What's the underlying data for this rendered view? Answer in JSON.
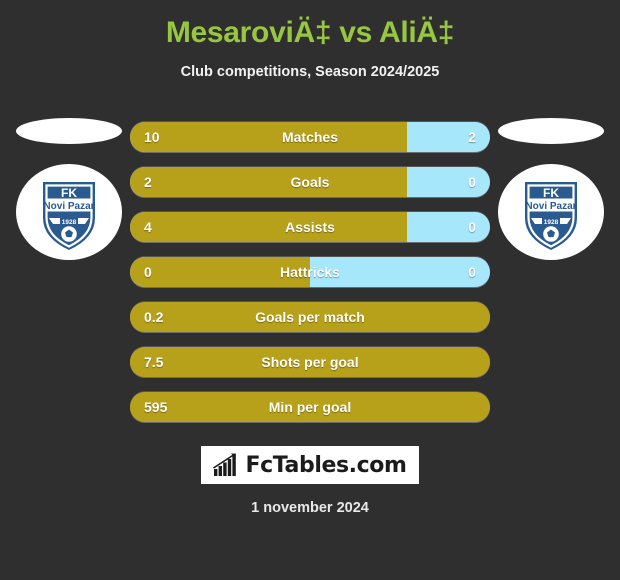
{
  "header": {
    "title": "MesaroviÄ‡ vs AliÄ‡",
    "subtitle": "Club competitions, Season 2024/2025"
  },
  "colors": {
    "background": "#302f2f",
    "title_green": "#97c63f",
    "home_gold": "#b8a11a",
    "away_blue": "#a6e7fb",
    "badge_white": "#ffffff",
    "crest_blue": "#2a5b90"
  },
  "badges": {
    "home": {
      "club_name": "FK Novi Pazar",
      "crest_line1": "FK",
      "crest_line2": "Novi Pazar",
      "crest_year": "1928",
      "icon": "club-crest-icon"
    },
    "away": {
      "club_name": "FK Novi Pazar",
      "crest_line1": "FK",
      "crest_line2": "Novi Pazar",
      "crest_year": "1928",
      "icon": "club-crest-icon"
    }
  },
  "chart_data": {
    "type": "bar",
    "title": "MesaroviÄ‡ vs AliÄ‡",
    "subtitle": "Club competitions, Season 2024/2025",
    "orientation": "horizontal-split",
    "categories": [
      "Matches",
      "Goals",
      "Assists",
      "Hattricks",
      "Goals per match",
      "Shots per goal",
      "Min per goal"
    ],
    "series": [
      {
        "name": "MesaroviÄ‡",
        "values": [
          "10",
          "2",
          "4",
          "0",
          "0.2",
          "7.5",
          "595"
        ]
      },
      {
        "name": "AliÄ‡",
        "values": [
          "2",
          "0",
          "0",
          "0",
          "",
          "",
          ""
        ]
      }
    ],
    "home_fill_percent": [
      77,
      77,
      77,
      50,
      100,
      100,
      100
    ],
    "legend": [
      "MesaroviÄ‡ (gold)",
      "AliÄ‡ (blue)"
    ],
    "grid": false
  },
  "rows": [
    {
      "label": "Matches",
      "home": "10",
      "away": "2",
      "fill": 77,
      "split": true
    },
    {
      "label": "Goals",
      "home": "2",
      "away": "0",
      "fill": 77,
      "split": true
    },
    {
      "label": "Assists",
      "home": "4",
      "away": "0",
      "fill": 77,
      "split": true
    },
    {
      "label": "Hattricks",
      "home": "0",
      "away": "0",
      "fill": 50,
      "split": true
    },
    {
      "label": "Goals per match",
      "home": "0.2",
      "away": "",
      "fill": 100,
      "split": false
    },
    {
      "label": "Shots per goal",
      "home": "7.5",
      "away": "",
      "fill": 100,
      "split": false
    },
    {
      "label": "Min per goal",
      "home": "595",
      "away": "",
      "fill": 100,
      "split": false
    }
  ],
  "footer": {
    "logo_text": "FcTables.com",
    "logo_icon": "bar-chart-trend-icon",
    "date": "1 november 2024"
  }
}
